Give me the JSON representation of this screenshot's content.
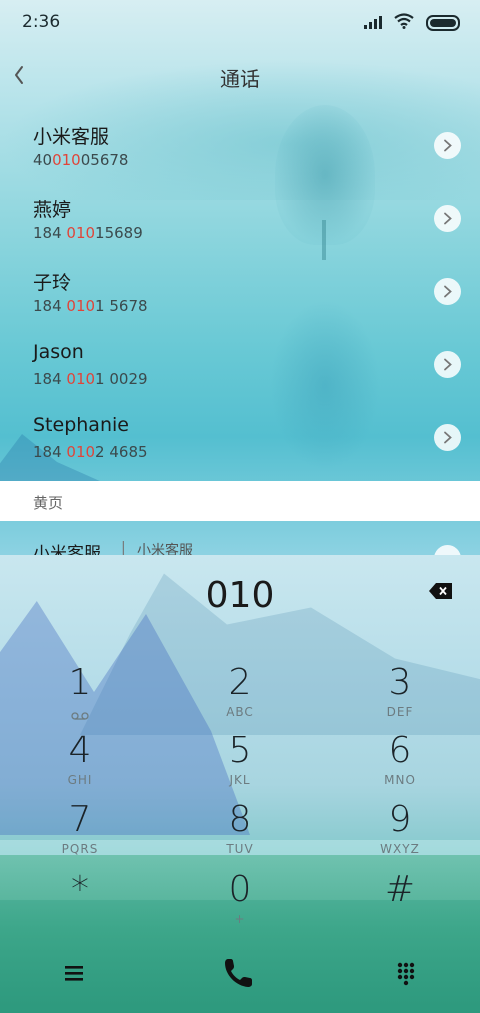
{
  "status": {
    "time": "2:36"
  },
  "header": {
    "title": "通话"
  },
  "contacts": [
    {
      "name": "小米客服",
      "num_pre": "40",
      "num_hl": "010",
      "num_post": "05678"
    },
    {
      "name": "燕婷",
      "num_pre": "184 ",
      "num_hl": "010",
      "num_post": "15689"
    },
    {
      "name": "子玲",
      "num_pre": "184 ",
      "num_hl": "010",
      "num_post": "1 5678"
    },
    {
      "name": "Jason",
      "num_pre": "184 ",
      "num_hl": "010",
      "num_post": "1 0029"
    },
    {
      "name": "Stephanie",
      "num_pre": "184 ",
      "num_hl": "010",
      "num_post": "2 4685"
    }
  ],
  "yellow_pages": {
    "section_label": "黄页",
    "entry_name": "小米客服",
    "separator": "|",
    "entry_sub": "小米客服"
  },
  "dialpad": {
    "input": "010",
    "keys": [
      {
        "digit": "1",
        "letters": ""
      },
      {
        "digit": "2",
        "letters": "ABC"
      },
      {
        "digit": "3",
        "letters": "DEF"
      },
      {
        "digit": "4",
        "letters": "GHI"
      },
      {
        "digit": "5",
        "letters": "JKL"
      },
      {
        "digit": "6",
        "letters": "MNO"
      },
      {
        "digit": "7",
        "letters": "PQRS"
      },
      {
        "digit": "8",
        "letters": "TUV"
      },
      {
        "digit": "9",
        "letters": "WXYZ"
      },
      {
        "digit": "*",
        "letters": ""
      },
      {
        "digit": "0",
        "letters": "+"
      },
      {
        "digit": "#",
        "letters": ""
      }
    ]
  },
  "colors": {
    "highlight": "#e0453a",
    "call_icon": "#1a1a1a"
  },
  "icons": [
    "back-icon",
    "chevron-right-icon",
    "backspace-icon",
    "voicemail-icon",
    "menu-icon",
    "phone-icon",
    "dialpad-icon"
  ]
}
